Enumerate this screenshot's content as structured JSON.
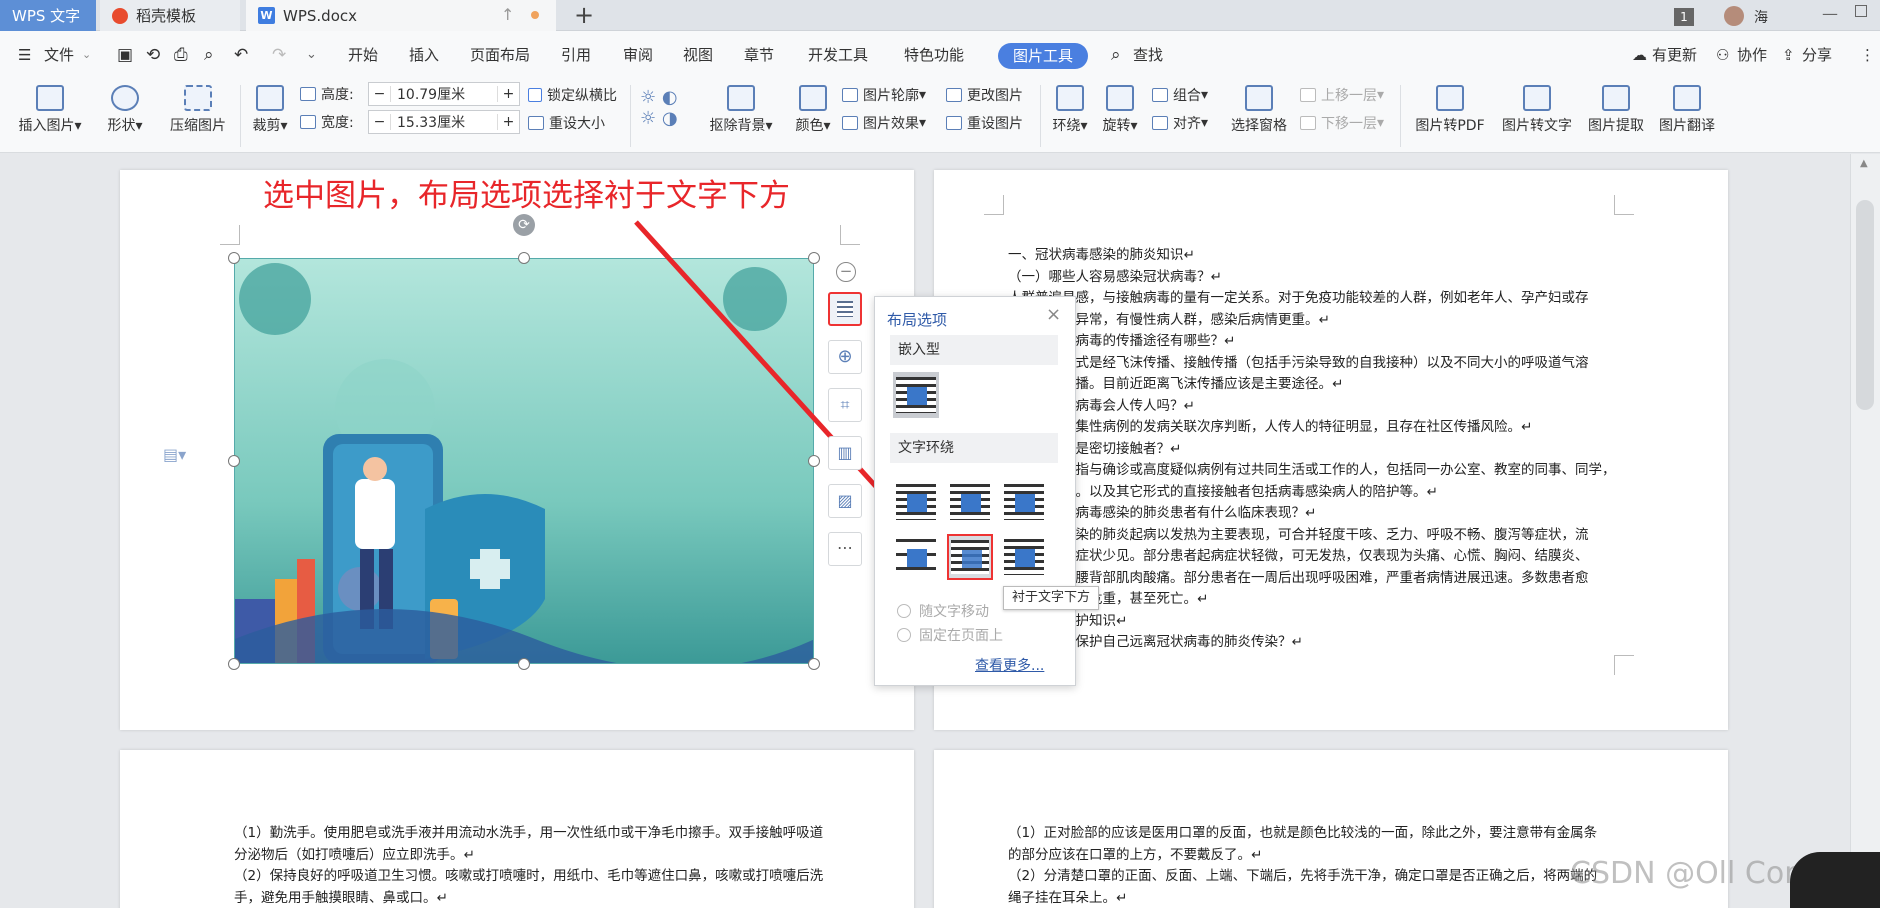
{
  "tabs": {
    "wps": "WPS 文字",
    "daoke": "稻壳模板",
    "doc": "WPS.docx",
    "badge": "1",
    "user": "海"
  },
  "menubar": {
    "file": "文件",
    "items": [
      "开始",
      "插入",
      "页面布局",
      "引用",
      "审阅",
      "视图",
      "章节",
      "开发工具",
      "特色功能"
    ],
    "picture_tools": "图片工具",
    "search": "查找",
    "update": "有更新",
    "collab": "协作",
    "share": "分享"
  },
  "ribbon": {
    "insert_picture": "插入图片",
    "shape": "形状",
    "compress": "压缩图片",
    "crop": "裁剪",
    "height_label": "高度:",
    "height_value": "10.79厘米",
    "width_label": "宽度:",
    "width_value": "15.33厘米",
    "lock_ratio": "锁定纵横比",
    "reset_size": "重设大小",
    "remove_bg": "抠除背景",
    "color": "颜色",
    "outline": "图片轮廓",
    "effect": "图片效果",
    "change_pic": "更改图片",
    "reset_pic": "重设图片",
    "wrap": "环绕",
    "rotate": "旋转",
    "group": "组合",
    "align": "对齐",
    "select_pane": "选择窗格",
    "bring_forward": "上移一层",
    "send_backward": "下移一层",
    "to_pdf": "图片转PDF",
    "to_text": "图片转文字",
    "extract": "图片提取",
    "translate": "图片翻译",
    "minus": "−",
    "plus": "+"
  },
  "annotation": "选中图片，布局选项选择衬于文字下方",
  "popup": {
    "title": "布局选项",
    "inline": "嵌入型",
    "wrap_text": "文字环绕",
    "move_with_text": "随文字移动",
    "fix_on_page": "固定在页面上",
    "see_more": "查看更多...",
    "tooltip": "衬于文字下方"
  },
  "page1_right_lines": [
    "一、冠状病毒感染的肺炎知识↵",
    "（一）哪些人容易感染冠状病毒？↵",
    "人群普遍易感，与接触病毒的量有一定关系。对于免疫功能较差的人群，例如老年人、孕产妇或存",
    "在肝肾功能异常，有慢性病人群，感染后病情更重。↵",
    "（二）冠状病毒的传播途径有哪些？↵",
    "主要传播方式是经飞沫传播、接触传播（包括手污染导致的自我接种）以及不同大小的呼吸道气溶",
    "胶近距离传播。目前近距离飞沫传播应该是主要途径。↵",
    "（三）冠状病毒会人传人吗？↵",
    "从目前的聚集性病例的发病关联次序判断，人传人的特征明显，且存在社区传播风险。↵",
    "（四）什么是密切接触者？↵",
    "密切接触者指与确诊或高度疑似病例有过共同生活或工作的人，包括同一办公室、教室的同事、同学，",
    "同一病房等。以及其它形式的直接接触者包括病毒感染病人的陪护等。↵",
    "（五）冠状病毒感染的肺炎患者有什么临床表现？↵",
    "冠状病毒感染的肺炎起病以发热为主要表现，可合并轻度干咳、乏力、呼吸不畅、腹泻等症状，流",
    "涕、咳痰等症状少见。部分患者起病症状轻微，可无发热，仅表现为头痛、心慌、胸闷、结膜炎、",
    "轻度四肢或腰背部肌肉酸痛。部分患者在一周后出现呼吸困难，严重者病情进展迅速。多数患者愈",
    "后良好，少数危重，甚至死亡。↵",
    "二、个人防护知识↵",
    "（一）如何保护自己远离冠状病毒的肺炎传染？↵"
  ],
  "page2_left_lines": [
    "（1）勤洗手。使用肥皂或洗手液并用流动水洗手，用一次性纸巾或干净毛巾擦手。双手接触呼吸道",
    "分泌物后（如打喷嚏后）应立即洗手。↵",
    "（2）保持良好的呼吸道卫生习惯。咳嗽或打喷嚏时，用纸巾、毛巾等遮住口鼻，咳嗽或打喷嚏后洗",
    "手，避免用手触摸眼睛、鼻或口。↵"
  ],
  "page2_right_lines": [
    "（1）正对脸部的应该是医用口罩的反面，也就是颜色比较浅的一面，除此之外，要注意带有金属条",
    "的部分应该在口罩的上方，不要戴反了。↵",
    "（2）分清楚口罩的正面、反面、上端、下端后，先将手洗干净，确定口罩是否正确之后，将两端的",
    "绳子挂在耳朵上。↵"
  ],
  "watermark": "CSDN @Oll Correct",
  "colors": {
    "accent": "#4a7fe0",
    "annotation": "#e8262a",
    "tab_active": "#5d8fd6"
  }
}
